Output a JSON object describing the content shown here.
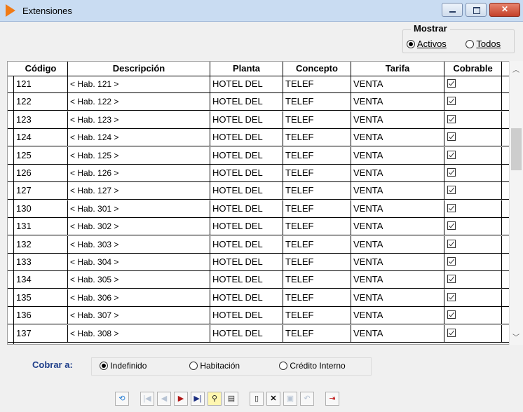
{
  "window": {
    "title": "Extensiones"
  },
  "mostrar": {
    "legend": "Mostrar",
    "options": [
      {
        "label": "Activos",
        "selected": true
      },
      {
        "label": "Todos",
        "selected": false
      }
    ]
  },
  "table": {
    "columns": [
      "Código",
      "Descripción",
      "Planta",
      "Concepto",
      "Tarifa",
      "Cobrable"
    ],
    "rows": [
      {
        "codigo": "121",
        "descripcion": "< Hab. 121 >",
        "planta": "HOTEL DEL",
        "concepto": "TELEF",
        "tarifa": "VENTA",
        "cobrable": true
      },
      {
        "codigo": "122",
        "descripcion": "< Hab. 122 >",
        "planta": "HOTEL DEL",
        "concepto": "TELEF",
        "tarifa": "VENTA",
        "cobrable": true
      },
      {
        "codigo": "123",
        "descripcion": "< Hab. 123 >",
        "planta": "HOTEL DEL",
        "concepto": "TELEF",
        "tarifa": "VENTA",
        "cobrable": true
      },
      {
        "codigo": "124",
        "descripcion": "< Hab. 124 >",
        "planta": "HOTEL DEL",
        "concepto": "TELEF",
        "tarifa": "VENTA",
        "cobrable": true
      },
      {
        "codigo": "125",
        "descripcion": "< Hab. 125 >",
        "planta": "HOTEL DEL",
        "concepto": "TELEF",
        "tarifa": "VENTA",
        "cobrable": true
      },
      {
        "codigo": "126",
        "descripcion": "< Hab. 126 >",
        "planta": "HOTEL DEL",
        "concepto": "TELEF",
        "tarifa": "VENTA",
        "cobrable": true
      },
      {
        "codigo": "127",
        "descripcion": "< Hab. 127 >",
        "planta": "HOTEL DEL",
        "concepto": "TELEF",
        "tarifa": "VENTA",
        "cobrable": true
      },
      {
        "codigo": "130",
        "descripcion": "< Hab. 301 >",
        "planta": "HOTEL DEL",
        "concepto": "TELEF",
        "tarifa": "VENTA",
        "cobrable": true
      },
      {
        "codigo": "131",
        "descripcion": "< Hab. 302 >",
        "planta": "HOTEL DEL",
        "concepto": "TELEF",
        "tarifa": "VENTA",
        "cobrable": true
      },
      {
        "codigo": "132",
        "descripcion": "< Hab. 303 >",
        "planta": "HOTEL DEL",
        "concepto": "TELEF",
        "tarifa": "VENTA",
        "cobrable": true
      },
      {
        "codigo": "133",
        "descripcion": "< Hab. 304 >",
        "planta": "HOTEL DEL",
        "concepto": "TELEF",
        "tarifa": "VENTA",
        "cobrable": true
      },
      {
        "codigo": "134",
        "descripcion": "< Hab. 305 >",
        "planta": "HOTEL DEL",
        "concepto": "TELEF",
        "tarifa": "VENTA",
        "cobrable": true
      },
      {
        "codigo": "135",
        "descripcion": "< Hab. 306 >",
        "planta": "HOTEL DEL",
        "concepto": "TELEF",
        "tarifa": "VENTA",
        "cobrable": true
      },
      {
        "codigo": "136",
        "descripcion": "< Hab. 307 >",
        "planta": "HOTEL DEL",
        "concepto": "TELEF",
        "tarifa": "VENTA",
        "cobrable": true
      },
      {
        "codigo": "137",
        "descripcion": "< Hab. 308 >",
        "planta": "HOTEL DEL",
        "concepto": "TELEF",
        "tarifa": "VENTA",
        "cobrable": true
      }
    ]
  },
  "cobrar": {
    "label": "Cobrar a:",
    "options": [
      {
        "label": "Indefinido",
        "selected": true
      },
      {
        "label": "Habitación",
        "selected": false
      },
      {
        "label": "Crédito Interno",
        "selected": false
      }
    ]
  },
  "toolbar": {
    "buttons": [
      {
        "icon": "refresh-icon",
        "enabled": true
      },
      {
        "icon": "first-record-icon",
        "enabled": false
      },
      {
        "icon": "prev-record-icon",
        "enabled": false
      },
      {
        "icon": "next-record-icon",
        "enabled": true
      },
      {
        "icon": "last-record-icon",
        "enabled": true
      },
      {
        "icon": "search-icon",
        "enabled": true
      },
      {
        "icon": "print-icon",
        "enabled": true
      },
      {
        "icon": "new-record-icon",
        "enabled": true
      },
      {
        "icon": "delete-icon",
        "enabled": true
      },
      {
        "icon": "save-icon",
        "enabled": false
      },
      {
        "icon": "undo-icon",
        "enabled": false
      },
      {
        "icon": "exit-icon",
        "enabled": true
      }
    ]
  },
  "colors": {
    "titlebar": "#c9dcf2",
    "accent": "#1f3f8a",
    "close": "#c4402a"
  }
}
